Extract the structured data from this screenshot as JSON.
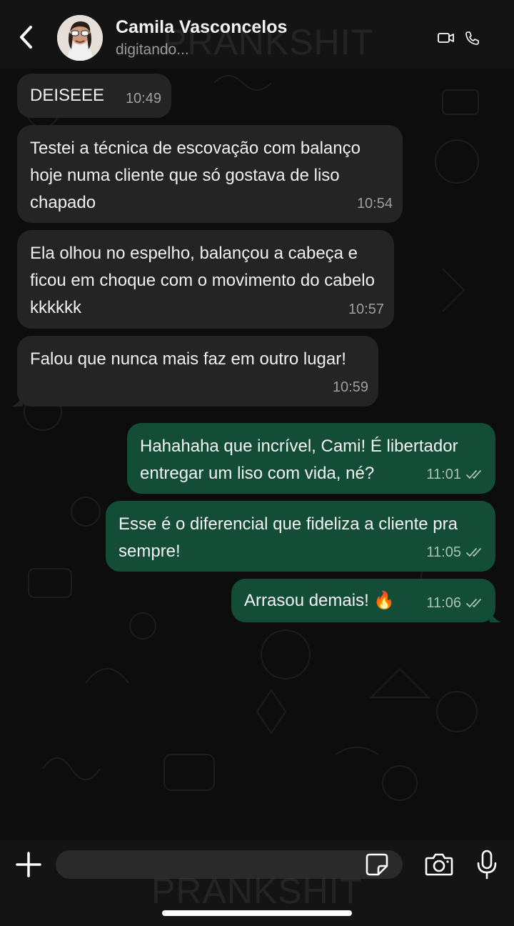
{
  "header": {
    "contact_name": "Camila Vasconcelos",
    "status": "digitando...",
    "watermark": "PRANKSHIT"
  },
  "messages": [
    {
      "direction": "in",
      "text": "DEISEEE",
      "time": "10:49"
    },
    {
      "direction": "in",
      "text": "Testei a técnica de escovação com balanço hoje numa cliente que só gostava de liso chapado",
      "time": "10:54"
    },
    {
      "direction": "in",
      "text": "Ela olhou no espelho, balançou a cabeça e ficou em choque com o movimento do cabelo kkkkkk",
      "time": "10:57"
    },
    {
      "direction": "in",
      "text": "Falou que nunca mais faz em outro lugar!",
      "time": "10:59"
    },
    {
      "direction": "out",
      "text": "Hahahaha que incrível, Cami! É libertador entregar um liso com vida, né?",
      "time": "11:01",
      "status": "read"
    },
    {
      "direction": "out",
      "text": "Esse é o diferencial que fideliza a cliente pra sempre!",
      "time": "11:05",
      "status": "read"
    },
    {
      "direction": "out",
      "text": "Arrasou demais! 🔥",
      "time": "11:06",
      "status": "read"
    }
  ],
  "composer": {
    "placeholder": ""
  },
  "icons": {
    "back": "chevron-left-icon",
    "video": "video-camera-icon",
    "call": "phone-icon",
    "plus": "plus-icon",
    "sticker": "sticker-icon",
    "camera": "camera-icon",
    "mic": "microphone-icon",
    "read": "double-check-icon"
  },
  "colors": {
    "incoming_bubble": "#242424",
    "outgoing_bubble": "#134d37",
    "header_bg": "#141414",
    "chat_bg": "#0d0d0d"
  }
}
